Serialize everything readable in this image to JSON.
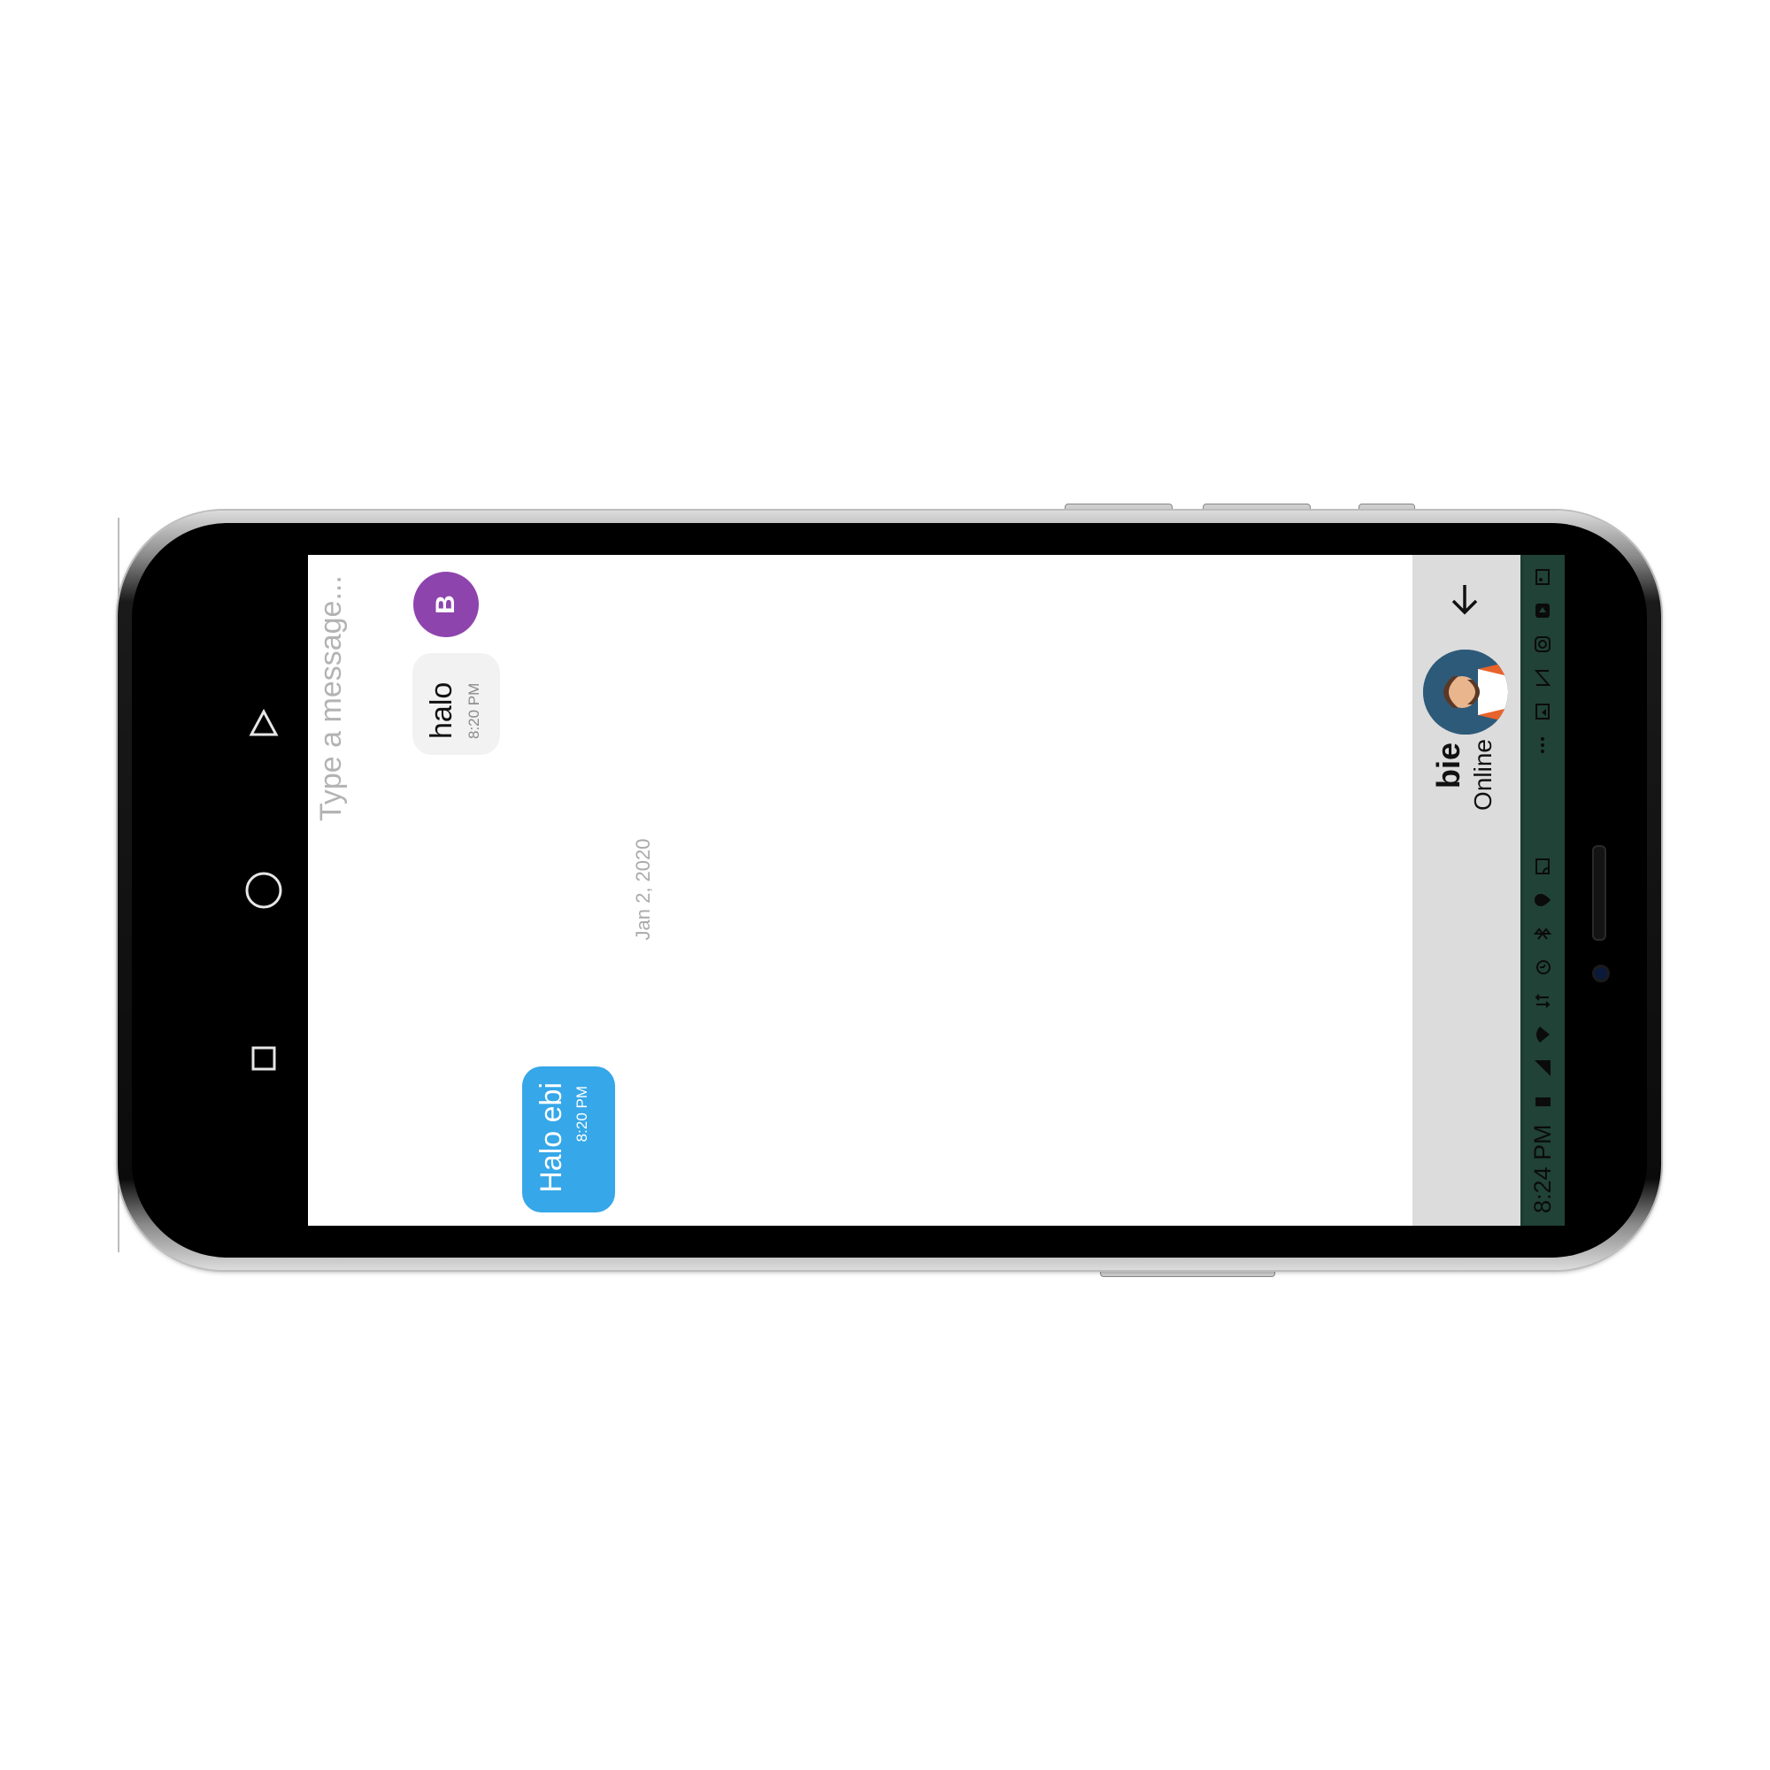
{
  "status_bar": {
    "time": "8:24 PM",
    "icons": [
      "image-icon",
      "video-icon",
      "instagram-icon",
      "lazada-icon",
      "gallery-icon",
      "more-icon",
      "cast-icon",
      "location-icon",
      "bluetooth-icon",
      "alarm-icon",
      "data-icon",
      "wifi-icon",
      "signal-icon",
      "battery-icon"
    ]
  },
  "header": {
    "contact_name": "bie",
    "contact_status": "Online"
  },
  "chat": {
    "date_separator": "Jan 2, 2020",
    "messages": [
      {
        "direction": "outgoing",
        "text": "Halo ebi",
        "time": "8:20 PM"
      },
      {
        "direction": "incoming",
        "text": "halo",
        "time": "8:20 PM",
        "avatar_letter": "B"
      }
    ]
  },
  "composer": {
    "placeholder": "Type a message..."
  },
  "colors": {
    "outgoing_bubble": "#36a7e8",
    "incoming_bubble": "#f2f2f2",
    "avatar_b": "#8e44ad",
    "status_bar": "#214236",
    "app_bar": "#dcdcdc"
  }
}
